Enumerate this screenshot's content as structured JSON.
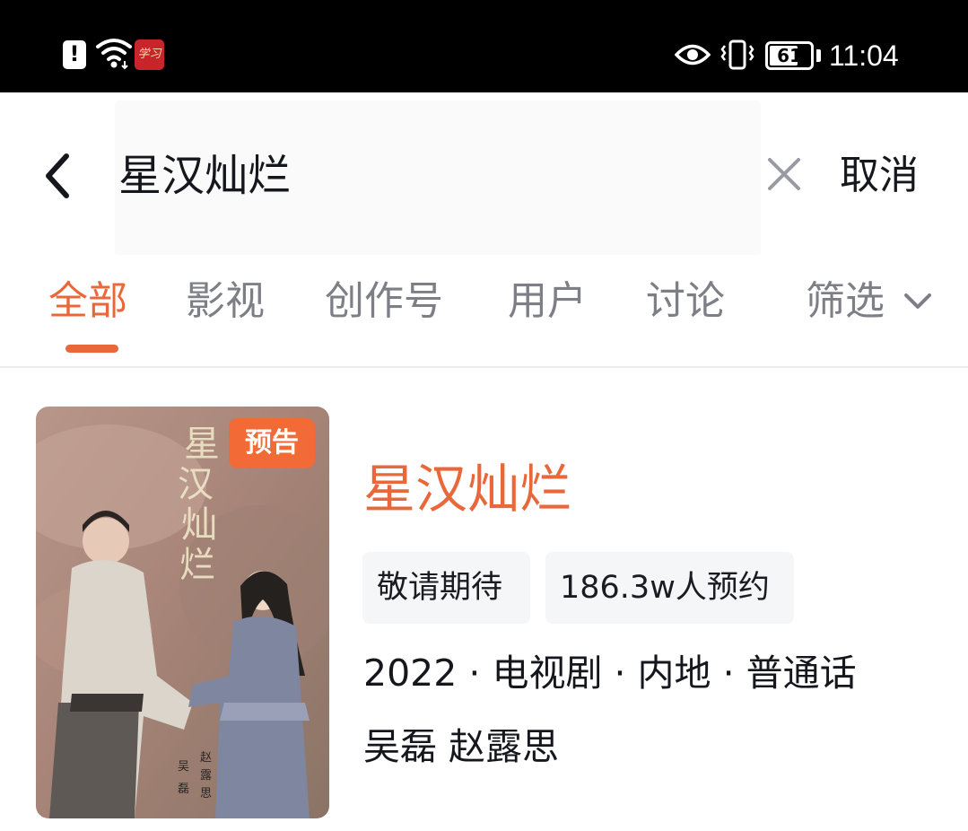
{
  "status_bar": {
    "time": "11:04",
    "battery_level": "61",
    "icons": [
      "alert-icon",
      "wifi-icon",
      "xuexi-app-icon",
      "eye-icon",
      "vibrate-icon",
      "battery-icon"
    ]
  },
  "search": {
    "query": "星汉灿烂",
    "cancel_label": "取消"
  },
  "tabs": {
    "items": [
      {
        "label": "全部",
        "active": true
      },
      {
        "label": "影视",
        "active": false
      },
      {
        "label": "创作号",
        "active": false
      },
      {
        "label": "用户",
        "active": false
      },
      {
        "label": "讨论",
        "active": false
      }
    ],
    "filter_label": "筛选"
  },
  "result": {
    "badge": "预告",
    "title": "星汉灿烂",
    "tags": [
      "敬请期待",
      "186.3w人预约"
    ],
    "meta": "2022 · 电视剧 · 内地 · 普通话",
    "cast": "吴磊 赵露思",
    "poster_title": "星汉灿烂",
    "poster_names": [
      "吴",
      "磊",
      "赵",
      "露",
      "思"
    ]
  },
  "colors": {
    "accent": "#e8683c",
    "badge": "#f26a36",
    "tab_inactive": "#7e7f86",
    "tag_bg": "#f5f6f8",
    "text": "#16171d"
  }
}
